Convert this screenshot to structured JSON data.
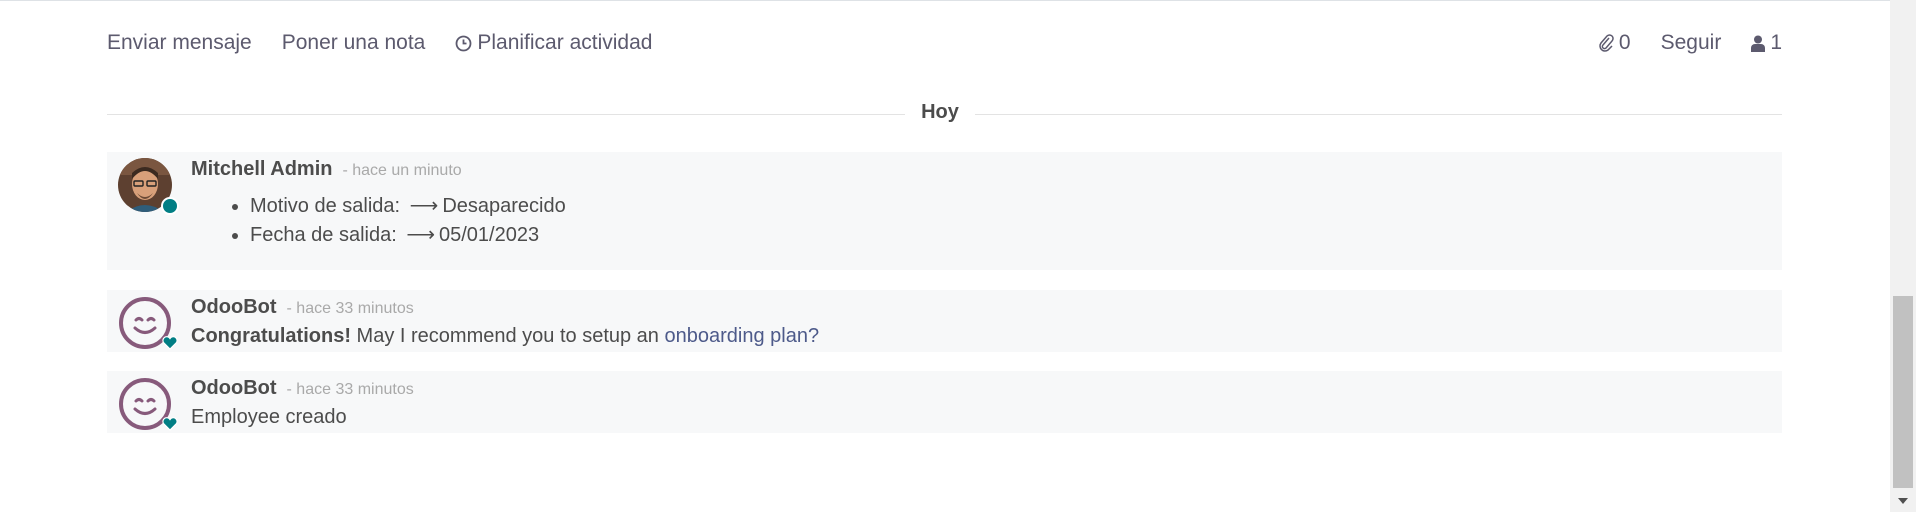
{
  "topbar": {
    "send_message": "Enviar mensaje",
    "log_note": "Poner una nota",
    "schedule_activity": "Planificar actividad",
    "attachments_count": "0",
    "follow": "Seguir",
    "followers_count": "1"
  },
  "separator": {
    "label": "Hoy"
  },
  "messages": [
    {
      "author": "Mitchell Admin",
      "date": "- hace un minuto",
      "tracking": [
        {
          "field": "Motivo de salida:",
          "arrow": "⟶",
          "value": "Desaparecido"
        },
        {
          "field": "Fecha de salida:",
          "arrow": "⟶",
          "value": "05/01/2023"
        }
      ]
    },
    {
      "author": "OdooBot",
      "date": "- hace 33 minutos",
      "bold": "Congratulations!",
      "text": " May I recommend you to setup an ",
      "link": "onboarding plan?"
    },
    {
      "author": "OdooBot",
      "date": "- hace 33 minutos",
      "text": "Employee creado"
    }
  ],
  "colors": {
    "accent": "#875a7b",
    "online": "#017e84",
    "message_bg": "#f7f8f9"
  },
  "icons": [
    "clock-icon",
    "paperclip-icon",
    "user-icon",
    "odoobot-avatar-icon",
    "heart-icon"
  ]
}
